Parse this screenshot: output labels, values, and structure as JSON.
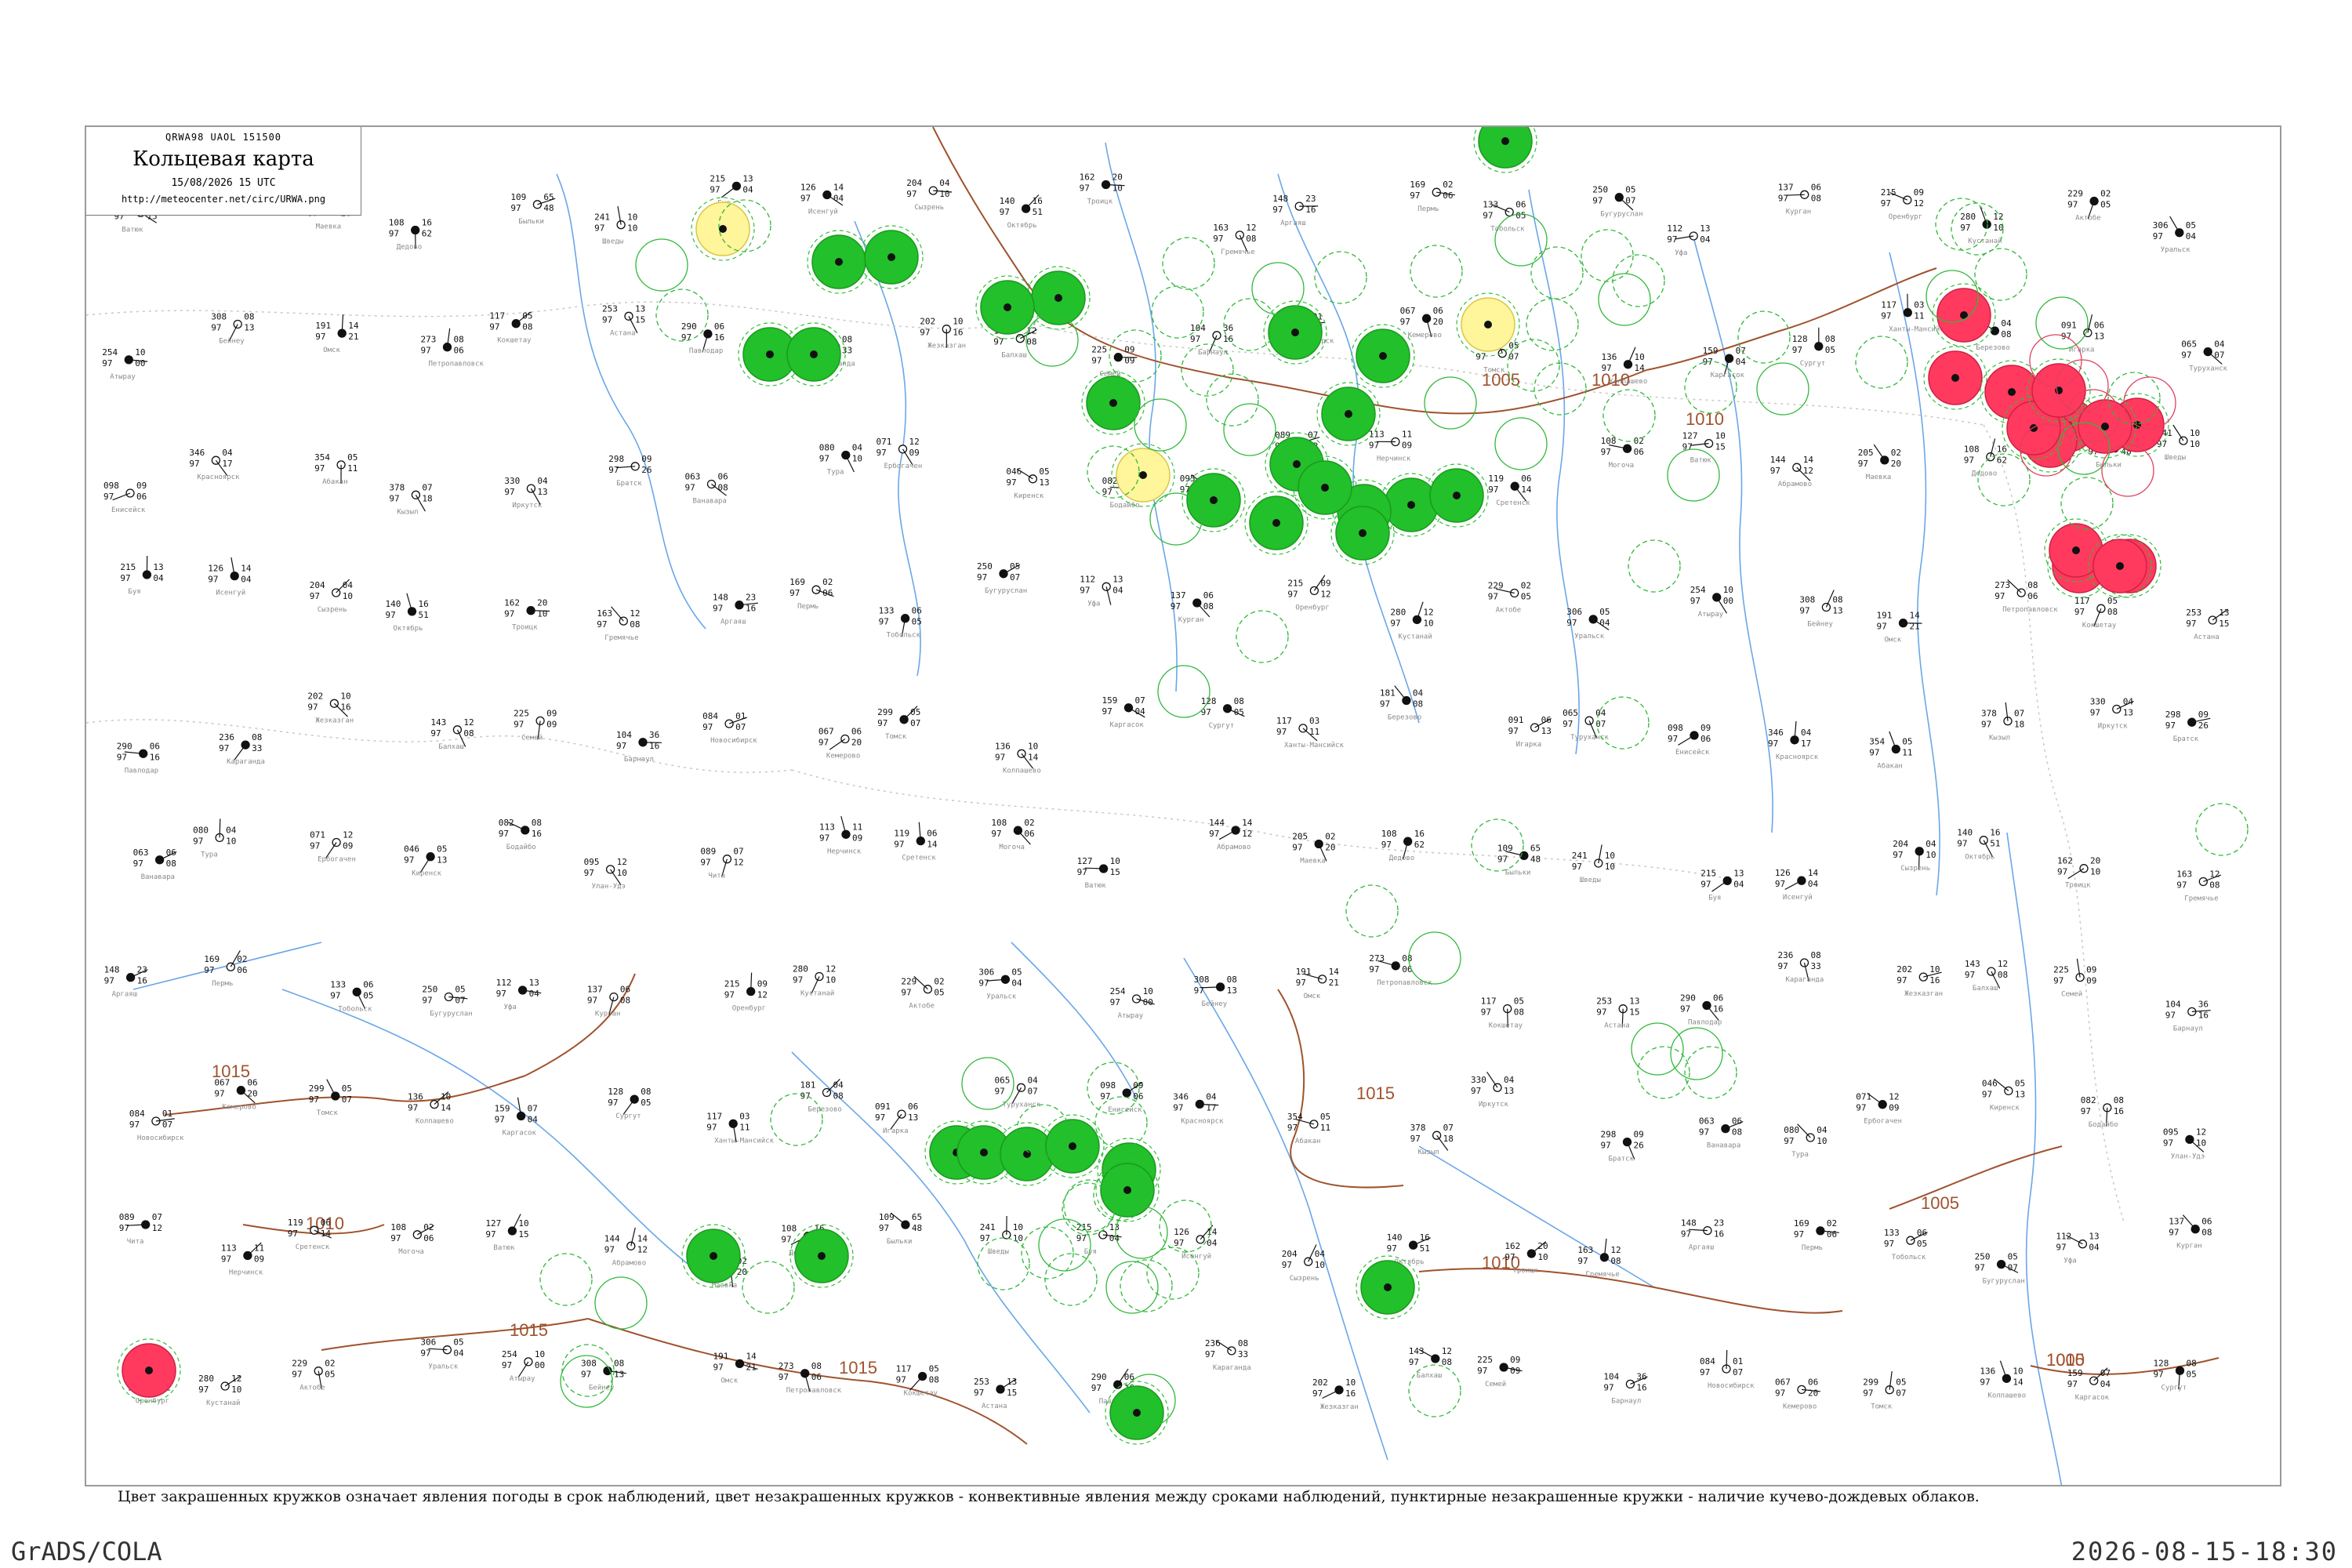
{
  "header": {
    "code": "QRWA98  UAOL  151500",
    "title": "Кольцевая карта",
    "datetime": "15/08/2026 15 UTC",
    "url": "http://meteocenter.net/circ/URWA.png"
  },
  "caption": "Цвет закрашенных кружков означает явления погоды в срок наблюдений, цвет незакрашенных кружков - конвективные явления между сроками наблюдений, пунктирные незакрашенные кружки - наличие кучево-дождевых облаков.",
  "footer": {
    "left": "GrADS/COLA",
    "right": "2026-08-15-18:30"
  },
  "colors": {
    "thunderstorm": "#22c02a",
    "shower": "#ff3a5e",
    "fog": "#fff59a",
    "isobar": "#a0522d",
    "river": "#6aa7e8",
    "border": "#c8c8c8"
  },
  "isobars": [
    {
      "label": "1010"
    },
    {
      "label": "1005"
    },
    {
      "label": "1010"
    },
    {
      "label": "1015"
    },
    {
      "label": "1015"
    },
    {
      "label": "1010"
    },
    {
      "label": "1015"
    },
    {
      "label": "1010"
    },
    {
      "label": "1015"
    },
    {
      "label": "1005"
    },
    {
      "label": "1010"
    },
    {
      "label": "1005"
    }
  ],
  "stations": [
    {
      "temp": "127",
      "p": "97",
      "dp": "10",
      "td": "15",
      "name": "Ватюк"
    },
    {
      "temp": "144",
      "p": "97",
      "dp": "14",
      "td": "12",
      "name": "Абрамово"
    },
    {
      "temp": "205",
      "p": "97",
      "dp": "02",
      "td": "20",
      "name": "Маевка"
    },
    {
      "temp": "108",
      "p": "97",
      "dp": "16",
      "td": "62",
      "name": "Дедово"
    },
    {
      "temp": "109",
      "p": "97",
      "dp": "65",
      "td": "48",
      "name": "Быльки"
    },
    {
      "temp": "241",
      "p": "97",
      "dp": "10",
      "td": "10",
      "name": "Шведы"
    },
    {
      "temp": "215",
      "p": "97",
      "dp": "13",
      "td": "04",
      "name": "Буя"
    },
    {
      "temp": "126",
      "p": "97",
      "dp": "14",
      "td": "04",
      "name": "Исенгуй"
    },
    {
      "temp": "204",
      "p": "97",
      "dp": "04",
      "td": "10",
      "name": "Сызрень"
    },
    {
      "temp": "140",
      "p": "97",
      "dp": "16",
      "td": "51",
      "name": "Октябрь"
    },
    {
      "temp": "162",
      "p": "97",
      "dp": "20",
      "td": "10",
      "name": "Троицк"
    },
    {
      "temp": "163",
      "p": "97",
      "dp": "12",
      "td": "08",
      "name": "Гремячье"
    },
    {
      "temp": "148",
      "p": "97",
      "dp": "23",
      "td": "16",
      "name": "Аргаяш"
    },
    {
      "temp": "169",
      "p": "97",
      "dp": "02",
      "td": "06",
      "name": "Пермь"
    },
    {
      "temp": "133",
      "p": "97",
      "dp": "06",
      "td": "05",
      "name": "Тобольск"
    },
    {
      "temp": "250",
      "p": "97",
      "dp": "05",
      "td": "07",
      "name": "Бугуруслан"
    },
    {
      "temp": "112",
      "p": "97",
      "dp": "13",
      "td": "04",
      "name": "Уфа"
    },
    {
      "temp": "137",
      "p": "97",
      "dp": "06",
      "td": "08",
      "name": "Курган"
    },
    {
      "temp": "215",
      "p": "97",
      "dp": "09",
      "td": "12",
      "name": "Оренбург"
    },
    {
      "temp": "280",
      "p": "97",
      "dp": "12",
      "td": "10",
      "name": "Кустанай"
    },
    {
      "temp": "229",
      "p": "97",
      "dp": "02",
      "td": "05",
      "name": "Актобе"
    },
    {
      "temp": "306",
      "p": "97",
      "dp": "05",
      "td": "04",
      "name": "Уральск"
    },
    {
      "temp": "254",
      "p": "97",
      "dp": "10",
      "td": "00",
      "name": "Атырау"
    },
    {
      "temp": "308",
      "p": "97",
      "dp": "08",
      "td": "13",
      "name": "Бейнеу"
    },
    {
      "temp": "191",
      "p": "97",
      "dp": "14",
      "td": "21",
      "name": "Омск"
    },
    {
      "temp": "273",
      "p": "97",
      "dp": "08",
      "td": "06",
      "name": "Петропавловск"
    },
    {
      "temp": "117",
      "p": "97",
      "dp": "05",
      "td": "08",
      "name": "Кокшетау"
    },
    {
      "temp": "253",
      "p": "97",
      "dp": "13",
      "td": "15",
      "name": "Астана"
    },
    {
      "temp": "290",
      "p": "97",
      "dp": "06",
      "td": "16",
      "name": "Павлодар"
    },
    {
      "temp": "236",
      "p": "97",
      "dp": "08",
      "td": "33",
      "name": "Караганда"
    },
    {
      "temp": "202",
      "p": "97",
      "dp": "10",
      "td": "16",
      "name": "Жезказган"
    },
    {
      "temp": "143",
      "p": "97",
      "dp": "12",
      "td": "08",
      "name": "Балхаш"
    },
    {
      "temp": "225",
      "p": "97",
      "dp": "09",
      "td": "09",
      "name": "Семей"
    },
    {
      "temp": "104",
      "p": "97",
      "dp": "36",
      "td": "16",
      "name": "Барнаул"
    },
    {
      "temp": "084",
      "p": "97",
      "dp": "01",
      "td": "07",
      "name": "Новосибирск"
    },
    {
      "temp": "067",
      "p": "97",
      "dp": "06",
      "td": "20",
      "name": "Кемерово"
    },
    {
      "temp": "299",
      "p": "97",
      "dp": "05",
      "td": "07",
      "name": "Томск"
    },
    {
      "temp": "136",
      "p": "97",
      "dp": "10",
      "td": "14",
      "name": "Колпашево"
    },
    {
      "temp": "159",
      "p": "97",
      "dp": "07",
      "td": "04",
      "name": "Каргасок"
    },
    {
      "temp": "128",
      "p": "97",
      "dp": "08",
      "td": "05",
      "name": "Сургут"
    },
    {
      "temp": "117",
      "p": "97",
      "dp": "03",
      "td": "11",
      "name": "Ханты-Мансийск"
    },
    {
      "temp": "181",
      "p": "97",
      "dp": "04",
      "td": "08",
      "name": "Березово"
    },
    {
      "temp": "091",
      "p": "97",
      "dp": "06",
      "td": "13",
      "name": "Игарка"
    },
    {
      "temp": "065",
      "p": "97",
      "dp": "04",
      "td": "07",
      "name": "Туруханск"
    },
    {
      "temp": "098",
      "p": "97",
      "dp": "09",
      "td": "06",
      "name": "Енисейск"
    },
    {
      "temp": "346",
      "p": "97",
      "dp": "04",
      "td": "17",
      "name": "Красноярск"
    },
    {
      "temp": "354",
      "p": "97",
      "dp": "05",
      "td": "11",
      "name": "Абакан"
    },
    {
      "temp": "378",
      "p": "97",
      "dp": "07",
      "td": "18",
      "name": "Кызыл"
    },
    {
      "temp": "330",
      "p": "97",
      "dp": "04",
      "td": "13",
      "name": "Иркутск"
    },
    {
      "temp": "298",
      "p": "97",
      "dp": "09",
      "td": "26",
      "name": "Братск"
    },
    {
      "temp": "063",
      "p": "97",
      "dp": "06",
      "td": "08",
      "name": "Ванавара"
    },
    {
      "temp": "080",
      "p": "97",
      "dp": "04",
      "td": "10",
      "name": "Тура"
    },
    {
      "temp": "071",
      "p": "97",
      "dp": "12",
      "td": "09",
      "name": "Ербогачен"
    },
    {
      "temp": "046",
      "p": "97",
      "dp": "05",
      "td": "13",
      "name": "Киренск"
    },
    {
      "temp": "082",
      "p": "97",
      "dp": "08",
      "td": "16",
      "name": "Бодайбо"
    },
    {
      "temp": "095",
      "p": "97",
      "dp": "12",
      "td": "10",
      "name": "Улан-Удэ"
    },
    {
      "temp": "089",
      "p": "97",
      "dp": "07",
      "td": "12",
      "name": "Чита"
    },
    {
      "temp": "113",
      "p": "97",
      "dp": "11",
      "td": "09",
      "name": "Нерчинск"
    },
    {
      "temp": "119",
      "p": "97",
      "dp": "06",
      "td": "14",
      "name": "Сретенск"
    },
    {
      "temp": "108",
      "p": "97",
      "dp": "02",
      "td": "06",
      "name": "Могоча"
    }
  ]
}
